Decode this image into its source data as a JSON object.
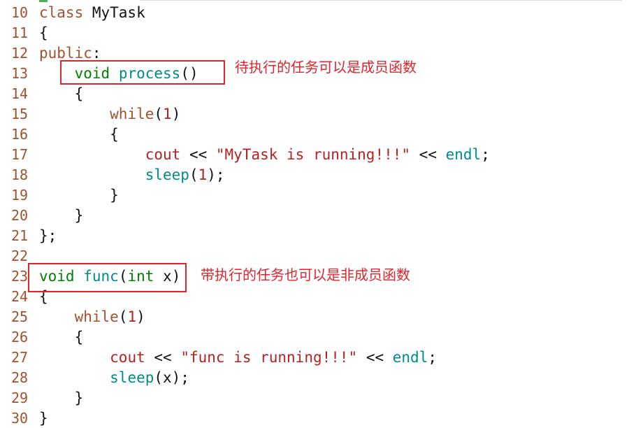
{
  "editor": {
    "lines": [
      {
        "no": "10",
        "tokens": [
          [
            "kw",
            "class"
          ],
          [
            "pl",
            " MyTask"
          ]
        ]
      },
      {
        "no": "11",
        "tokens": [
          [
            "pl",
            "{"
          ]
        ]
      },
      {
        "no": "12",
        "tokens": [
          [
            "kw",
            "public"
          ],
          [
            "pl",
            ":"
          ]
        ]
      },
      {
        "no": "13",
        "tokens": [
          [
            "pl",
            "    "
          ],
          [
            "ty",
            "void"
          ],
          [
            "pl",
            " "
          ],
          [
            "fn",
            "process"
          ],
          [
            "pl",
            "()"
          ]
        ]
      },
      {
        "no": "14",
        "tokens": [
          [
            "pl",
            "    {"
          ]
        ]
      },
      {
        "no": "15",
        "tokens": [
          [
            "pl",
            "        "
          ],
          [
            "kw",
            "while"
          ],
          [
            "pl",
            "("
          ],
          [
            "num",
            "1"
          ],
          [
            "pl",
            ")"
          ]
        ]
      },
      {
        "no": "16",
        "tokens": [
          [
            "pl",
            "        {"
          ]
        ]
      },
      {
        "no": "17",
        "tokens": [
          [
            "pl",
            "            "
          ],
          [
            "id",
            "cout"
          ],
          [
            "pl",
            " << "
          ],
          [
            "str",
            "\"MyTask is running!!!\""
          ],
          [
            "pl",
            " << "
          ],
          [
            "fn",
            "endl"
          ],
          [
            "pl",
            ";"
          ]
        ]
      },
      {
        "no": "18",
        "tokens": [
          [
            "pl",
            "            "
          ],
          [
            "fn",
            "sleep"
          ],
          [
            "pl",
            "("
          ],
          [
            "num",
            "1"
          ],
          [
            "pl",
            ");"
          ]
        ]
      },
      {
        "no": "19",
        "tokens": [
          [
            "pl",
            "        }"
          ]
        ]
      },
      {
        "no": "20",
        "tokens": [
          [
            "pl",
            "    }"
          ]
        ]
      },
      {
        "no": "21",
        "tokens": [
          [
            "pl",
            "};"
          ]
        ]
      },
      {
        "no": "22",
        "tokens": []
      },
      {
        "no": "23",
        "tokens": [
          [
            "ty",
            "void"
          ],
          [
            "pl",
            " "
          ],
          [
            "fn",
            "func"
          ],
          [
            "pl",
            "("
          ],
          [
            "ty",
            "int"
          ],
          [
            "pl",
            " x)"
          ]
        ]
      },
      {
        "no": "24",
        "tokens": [
          [
            "pl",
            "{"
          ]
        ]
      },
      {
        "no": "25",
        "tokens": [
          [
            "pl",
            "    "
          ],
          [
            "kw",
            "while"
          ],
          [
            "pl",
            "("
          ],
          [
            "num",
            "1"
          ],
          [
            "pl",
            ")"
          ]
        ]
      },
      {
        "no": "26",
        "tokens": [
          [
            "pl",
            "    {"
          ]
        ]
      },
      {
        "no": "27",
        "tokens": [
          [
            "pl",
            "        "
          ],
          [
            "id",
            "cout"
          ],
          [
            "pl",
            " << "
          ],
          [
            "str",
            "\"func is running!!!\""
          ],
          [
            "pl",
            " << "
          ],
          [
            "fn",
            "endl"
          ],
          [
            "pl",
            ";"
          ]
        ]
      },
      {
        "no": "28",
        "tokens": [
          [
            "pl",
            "        "
          ],
          [
            "fn",
            "sleep"
          ],
          [
            "pl",
            "(x);"
          ]
        ]
      },
      {
        "no": "29",
        "tokens": [
          [
            "pl",
            "    }"
          ]
        ]
      },
      {
        "no": "30",
        "tokens": [
          [
            "pl",
            "}"
          ]
        ]
      }
    ]
  },
  "annotations": {
    "member_note": "待执行的任务可以是成员函数",
    "nonmember_note": "带执行的任务也可以是非成员函数"
  },
  "colors": {
    "keyword": "#a0522d",
    "type": "#008000",
    "function": "#008b8b",
    "literal": "#b22222",
    "annotation": "#e0242c"
  }
}
